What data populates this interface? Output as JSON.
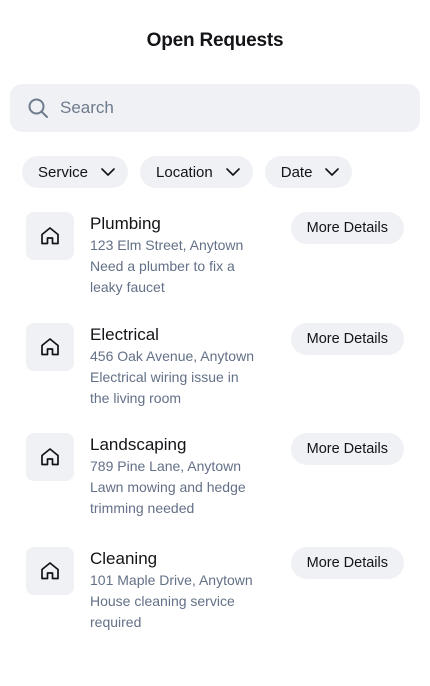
{
  "header": {
    "title": "Open Requests"
  },
  "search": {
    "placeholder": "Search",
    "icon": "search-icon"
  },
  "filters": [
    {
      "label": "Service",
      "icon": "chevron-down-icon"
    },
    {
      "label": "Location",
      "icon": "chevron-down-icon"
    },
    {
      "label": "Date",
      "icon": "chevron-down-icon"
    }
  ],
  "requests": [
    {
      "icon": "house-icon",
      "title": "Plumbing",
      "address": "123 Elm Street, Anytown",
      "description": "Need a plumber to fix a leaky faucet",
      "button": "More Details"
    },
    {
      "icon": "house-icon",
      "title": "Electrical",
      "address": "456 Oak Avenue, Anytown",
      "description": "Electrical wiring issue in the living room",
      "button": "More Details"
    },
    {
      "icon": "house-icon",
      "title": "Landscaping",
      "address": "789 Pine Lane, Anytown",
      "description": "Lawn mowing and hedge trimming needed",
      "button": "More Details"
    },
    {
      "icon": "house-icon",
      "title": "Cleaning",
      "address": "101 Maple Drive, Anytown",
      "description": "House cleaning service required",
      "button": "More Details"
    }
  ]
}
